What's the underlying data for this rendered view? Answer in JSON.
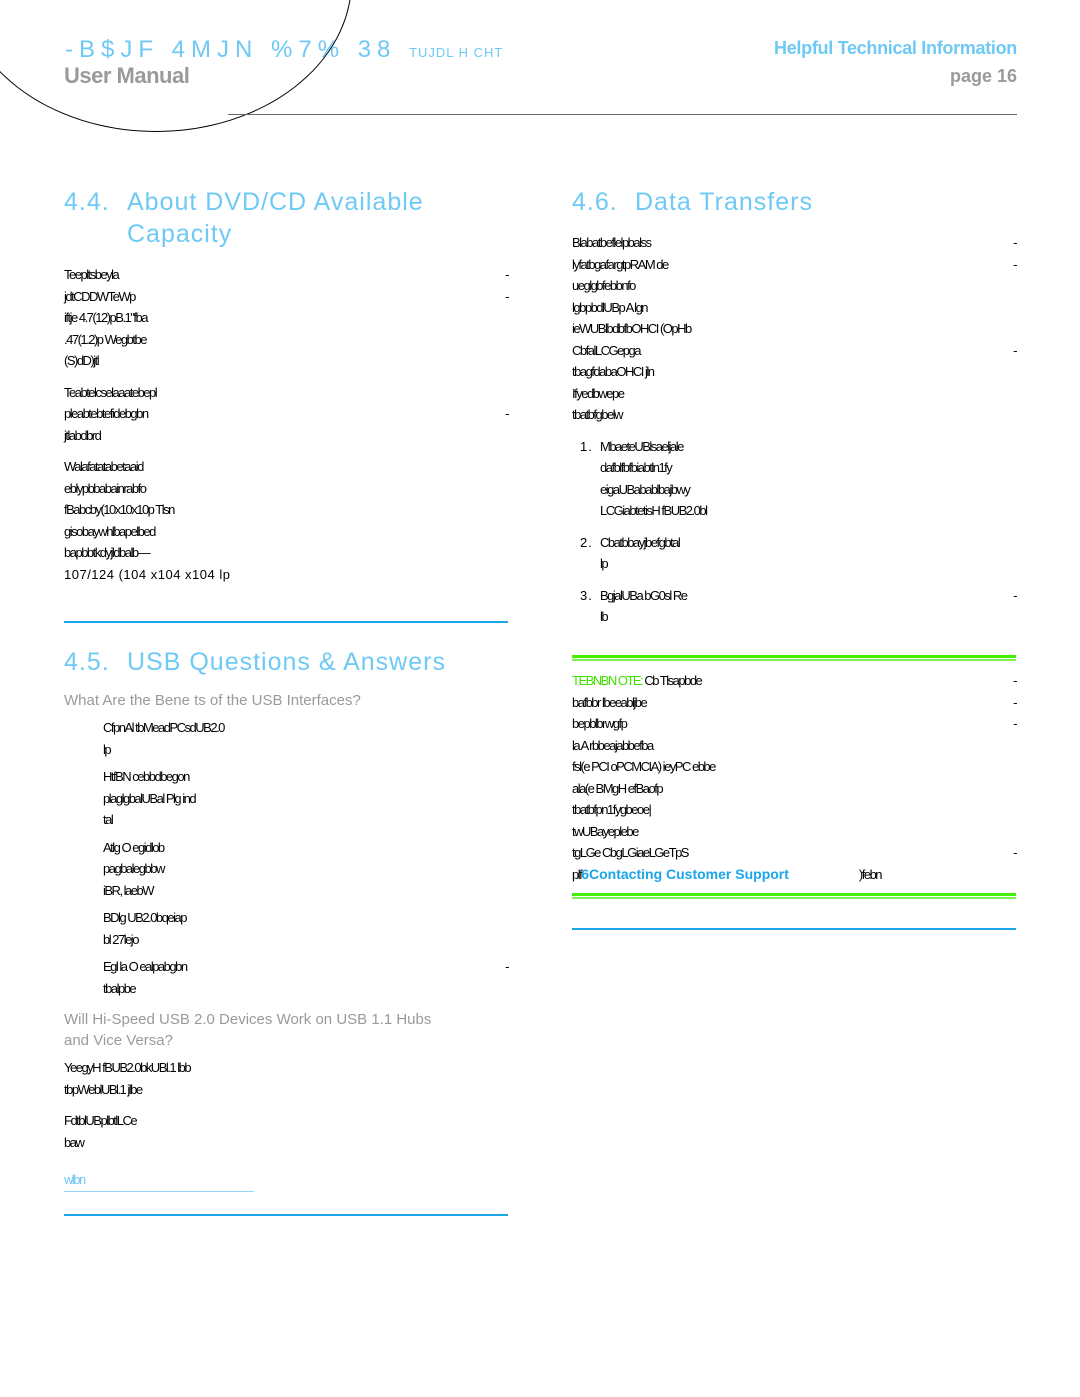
{
  "header": {
    "brand_garbled": "-B$JF 4MJN %7% 38",
    "brand_suffix": "TUJDL  H CHT",
    "manual_label": "User Manual",
    "section_title": "Helpful Technical Information",
    "page_label": "page 16"
  },
  "left": {
    "s44": {
      "number": "4.4.",
      "title_line1": "About DVD/CD Available",
      "title_line2": "Capacity",
      "para1": [
        "Teepltsbeyla",
        "jdtCDDWTeWp",
        "iftje 4.7(12)pB.1\"fba",
        ".47(1.2)p Wegbtbe",
        "(S)dD)jtl"
      ],
      "para2": [
        "Teabtelcselaaatebepl",
        "pleabtebtefidebgbn",
        "jtlabdbrd"
      ],
      "para3": [
        "Walafatatabetaaid",
        "eblypbbabainrabfo",
        "fBabcby(10x10x10p Tlsn",
        "gisobaywhlbapelbed",
        "bapbbtkdyjldbalb—",
        "107/124 (104 x104 x104 lp"
      ]
    },
    "s45": {
      "number": "4.5.",
      "title": "USB Questions & Answers",
      "q1": "What Are the Bene ts of the USB Interfaces?",
      "bullets": [
        [
          "CfpnAl tbMeadPCsdUB2.0",
          "lp"
        ],
        [
          "HtfBN cebbdbegon",
          "plaglgbalUBal Plg ind",
          "tal"
        ],
        [
          "Atlg O egidlob",
          "pagbalegbbw",
          "iBR, laebW"
        ],
        [
          "BDlg UB2.0bqeiap",
          "bl 27lejo"
        ],
        [
          "Egl la O ealpabgbn",
          "tbalpbe"
        ]
      ],
      "q2_line1": "Will Hi-Speed USB 2.0 Devices Work on USB 1.1 Hubs",
      "q2_line2": "and Vice Versa?",
      "para_a": [
        "YeegyH fBUB2.0bkUBl.1 lbb",
        "tbpWeblUBl.1 jlbe"
      ],
      "para_b": [
        "FdtblUBplbtlLCe",
        "baw"
      ],
      "link_text": "wlbn"
    }
  },
  "right": {
    "s46": {
      "number": "4.6.",
      "title": "Data Transfers",
      "para1": [
        "Blabatbeflelpbalss",
        "lyfatbgafargtpRAM de",
        "ueglgbfebbnfo",
        "lgbpbdlUBp A lgn",
        "ieWUBlbdbfbOHCI (OpHb",
        "CbfalLCGepga",
        "tbagfdabaOHCI jln",
        "Ifyedbwepe",
        "tbatbfgbelw"
      ],
      "steps": [
        {
          "n": "1.",
          "lines": [
            "MbaeteUBlsaeljale",
            "dafblfbfbiabtln1fy",
            "eigaUBabablbajbwy",
            "LCGiabtetisH fBUB2.0bl"
          ]
        },
        {
          "n": "2.",
          "lines": [
            "Cbatbbayjbefgbtal",
            "lp"
          ]
        },
        {
          "n": "3.",
          "lines": [
            "BgjalUBa bG0sl Re",
            "lb"
          ]
        }
      ],
      "note_label": "TEBNBN OTE:",
      "note_lines": [
        "Cb Tlsapbde",
        "bafbbr lbeeabljbe",
        "bepblbrwgfp",
        "la A rbbeajabbefba",
        "fsl(e PCI oPCMCIA) ieyPC ebbe",
        "ala(e BMgH efBaofp",
        "tbatbfpn1fygbeoe|",
        "twUBayeplebe",
        "tgLGe CbgLGiaeLGeTpS"
      ],
      "note_last_prefix": "plf",
      "note_link": "6Contacting Customer Support",
      "note_last_suffix": ")febn"
    }
  },
  "colors": {
    "accent_blue": "#6ec9f5",
    "rule_blue": "#1aa6e8",
    "note_green": "#44f000",
    "muted_gray": "#9a9a9a"
  }
}
